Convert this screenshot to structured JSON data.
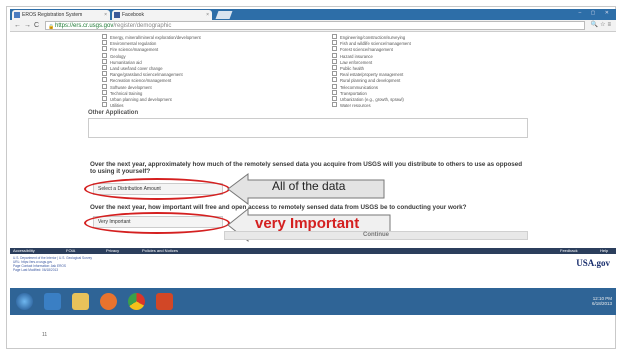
{
  "browser": {
    "tabs": [
      {
        "label": "EROS Registration System"
      },
      {
        "label": "Facebook"
      }
    ],
    "url_host": "https://ers.cr.usgs.gov",
    "url_path": "/register/demographic"
  },
  "applications_left": [
    "Energy, mineral/mineral exploration/development",
    "Environmental regulation",
    "Fire science/management",
    "Geology",
    "Humanitarian aid",
    "Land use/land cover change",
    "Range/grassland science/management",
    "Recreation science/management",
    "Software development",
    "Technical training",
    "Urban planning and development",
    "Utilities"
  ],
  "applications_right": [
    "Engineering/construction/surveying",
    "Fish and wildlife science/management",
    "Forest science/management",
    "Hazard insurance",
    "Law enforcement",
    "Public health",
    "Real estate/property management",
    "Rural planning and development",
    "Telecommunications",
    "Transportation",
    "Urbanization (e.g., growth, sprawl)",
    "Water resources"
  ],
  "other_application_label": "Other Application",
  "question1": "Over the next year, approximately how much of the remotely sensed data you acquire from USGS will you distribute to others to use as opposed to using it yourself?",
  "distribution_select": "Select a Distribution Amount",
  "question2": "Over the next year, how important will free and open access to remotely sensed data from USGS be to conducting your work?",
  "importance_select": "Very Important",
  "continue_label": "Continue",
  "callout1": "All of the data",
  "callout2": "very Important",
  "footer": {
    "links": [
      "Accessibility",
      "FOIA",
      "Privacy",
      "Policies and Notices"
    ],
    "feedback": "Feedback",
    "help": "Help",
    "lines": [
      "U.S. Department of the Interior | U.S. Geological Survey",
      "URL: https://ers.cr.usgs.gov",
      "Page Contact Information: Ask EROS",
      "Page Last Modified: 06/18/2013"
    ],
    "usa_logo": "USA.gov"
  },
  "taskbar": {
    "time": "12:10 PM",
    "date": "6/18/2013"
  },
  "slide_number": "11",
  "colors": {
    "accent_red": "#d42020",
    "footer_blue": "#2b3e5c",
    "taskbar_blue": "#2f6496"
  }
}
